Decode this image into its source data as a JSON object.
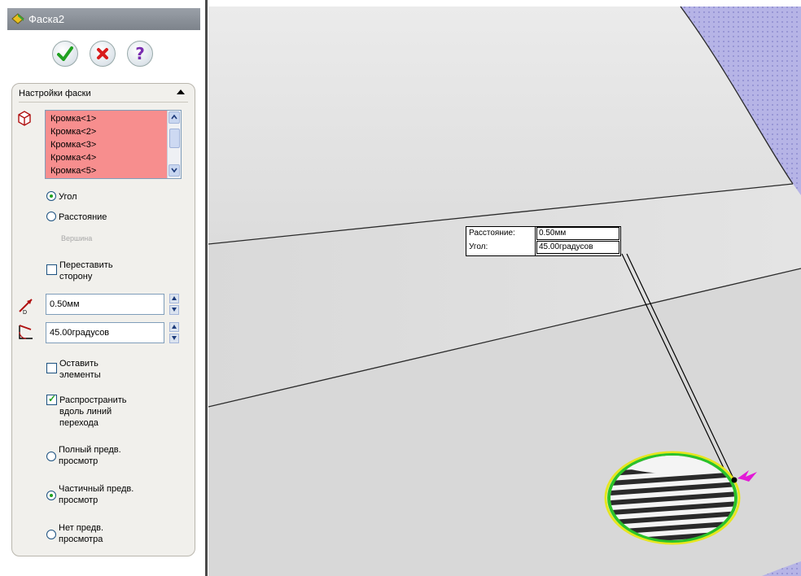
{
  "feature": {
    "title": "Фаска2",
    "buttons": {
      "ok": "ok-button",
      "cancel": "cancel-button",
      "help": "help-button",
      "help_glyph": "?"
    }
  },
  "group": {
    "title": "Настройки фаски",
    "edges": [
      "Кромка<1>",
      "Кромка<2>",
      "Кромка<3>",
      "Кромка<4>",
      "Кромка<5>"
    ],
    "type_options": [
      {
        "label": "Угол",
        "selected": true
      },
      {
        "label": "Расстояние",
        "selected": false
      },
      {
        "label": "Вершина",
        "selected": false,
        "disabled": true
      }
    ],
    "flip_direction": {
      "label_line1": "Переставить",
      "label_line2": "сторону",
      "checked": false
    },
    "distance": {
      "value": "0.50мм"
    },
    "angle": {
      "value": "45.00градусов"
    },
    "keep_features": {
      "label_line1": "Оставить",
      "label_line2": "элементы",
      "checked": false
    },
    "tangent_propagation": {
      "label_line1": "Распространить",
      "label_line2": "вдоль линий",
      "label_line3": "перехода",
      "checked": true
    },
    "preview_options": [
      {
        "line1": "Полный предв.",
        "line2": "просмотр",
        "selected": false
      },
      {
        "line1": "Частичный предв.",
        "line2": "просмотр",
        "selected": true
      },
      {
        "line1": "Нет предв.",
        "line2": "просмотра",
        "selected": false
      }
    ]
  },
  "callout": {
    "distance_label": "Расстояние:",
    "distance_value": "0.50мм",
    "angle_label": "Угол:",
    "angle_value": "45.00градусов"
  },
  "colors": {
    "selection_list_bg": "#f78e8e",
    "hole_highlight_outer": "#e6e61e",
    "hole_highlight_inner": "#2ac22a",
    "handle": "#e21ad6",
    "background_pattern": "#a8a6dc"
  }
}
